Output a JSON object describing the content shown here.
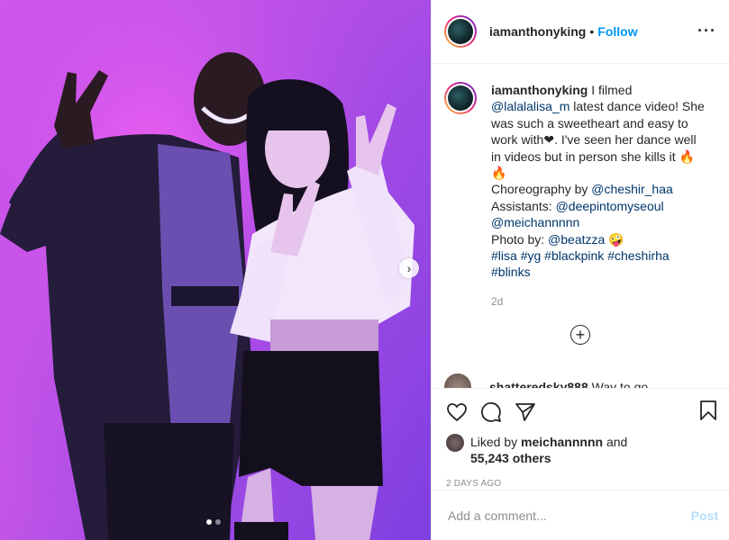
{
  "post": {
    "username": "iamanthonyking",
    "separator": "•",
    "follow_label": "Follow",
    "more_icon": "more-horizontal-icon",
    "caption_lines": [
      [
        {
          "t": "iamanthonyking",
          "k": "user"
        },
        {
          "t": " I filmed ",
          "k": "text"
        }
      ],
      [
        {
          "t": "@lalalalisa_m",
          "k": "mention"
        },
        {
          "t": " latest dance video! She",
          "k": "text"
        }
      ],
      [
        {
          "t": "was such a sweetheart and easy to",
          "k": "text"
        }
      ],
      [
        {
          "t": "work with❤. I've seen her dance well",
          "k": "text"
        }
      ],
      [
        {
          "t": "in videos but in person she kills it 🔥",
          "k": "text"
        }
      ],
      [
        {
          "t": "🔥",
          "k": "text"
        }
      ],
      [
        {
          "t": "Choreography by ",
          "k": "text"
        },
        {
          "t": "@cheshir_haa",
          "k": "mention"
        }
      ],
      [
        {
          "t": "Assistants: ",
          "k": "text"
        },
        {
          "t": "@deepintomyseoul",
          "k": "mention"
        }
      ],
      [
        {
          "t": "@meichannnnn",
          "k": "mention"
        }
      ],
      [
        {
          "t": "Photo by: ",
          "k": "text"
        },
        {
          "t": "@beatzza",
          "k": "mention"
        },
        {
          "t": " 🤪",
          "k": "text"
        }
      ],
      [
        {
          "t": "#lisa",
          "k": "mention"
        },
        {
          "t": " ",
          "k": "text"
        },
        {
          "t": "#yg",
          "k": "mention"
        },
        {
          "t": " ",
          "k": "text"
        },
        {
          "t": "#blackpink",
          "k": "mention"
        },
        {
          "t": " ",
          "k": "text"
        },
        {
          "t": "#cheshirha",
          "k": "mention"
        }
      ],
      [
        {
          "t": "#blinks",
          "k": "mention"
        }
      ]
    ],
    "caption_time": "2d",
    "partial_comment": {
      "user": "shatteredsky888",
      "text": " Way to go"
    },
    "liked_by_prefix": "Liked by ",
    "liked_by_user": "meichannnnn",
    "liked_by_and": " and",
    "likes_count": "55,243 others",
    "timestamp": "2 DAYS AGO",
    "comment_placeholder": "Add a comment...",
    "post_label": "Post",
    "carousel": {
      "current": 1,
      "total": 2
    }
  },
  "colors": {
    "link": "#00376b",
    "accent": "#0095f6",
    "muted": "#8e8e8e"
  }
}
